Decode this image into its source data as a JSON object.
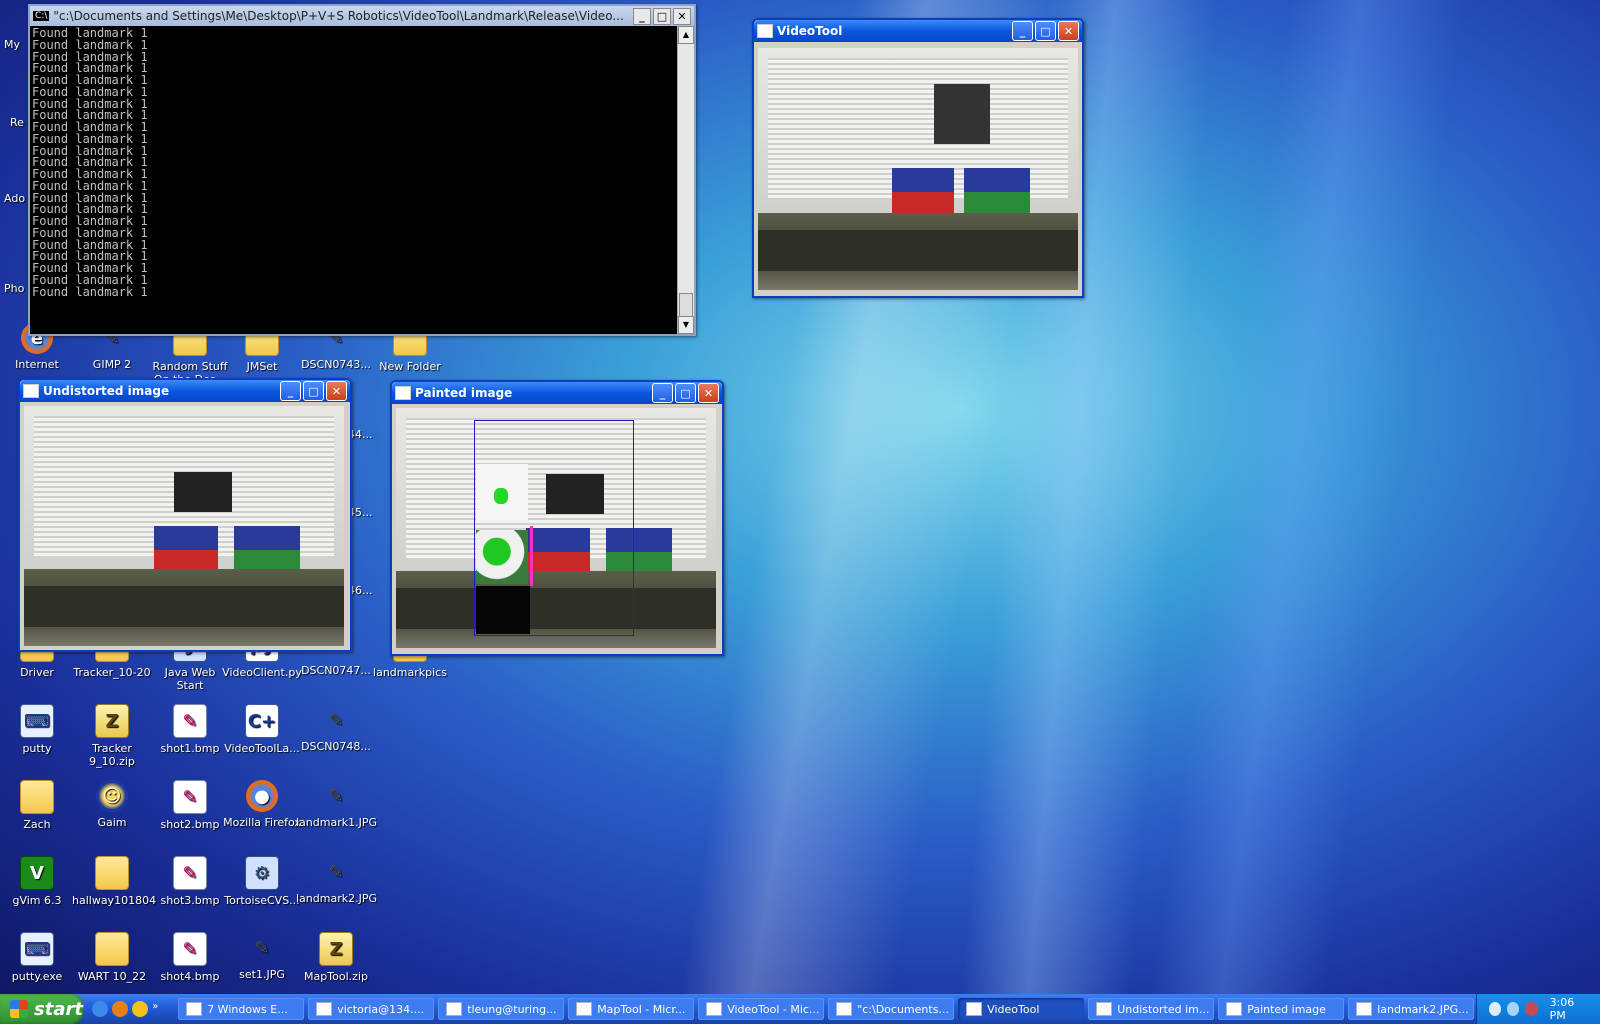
{
  "console": {
    "title": "\"c:\\Documents and Settings\\Me\\Desktop\\P+V+S Robotics\\VideoTool\\Landmark\\Release\\Video...",
    "lines": [
      "Found landmark 1",
      "Found landmark 1",
      "Found landmark 1",
      "Found landmark 1",
      "Found landmark 1",
      "Found landmark 1",
      "Found landmark 1",
      "Found landmark 1",
      "Found landmark 1",
      "Found landmark 1",
      "Found landmark 1",
      "Found landmark 1",
      "Found landmark 1",
      "Found landmark 1",
      "Found landmark 1",
      "Found landmark 1",
      "Found landmark 1",
      "Found landmark 1",
      "Found landmark 1",
      "Found landmark 1",
      "Found landmark 1",
      "Found landmark 1",
      "Found landmark 1"
    ]
  },
  "windows": {
    "videotool": {
      "title": "VideoTool"
    },
    "undistorted": {
      "title": "Undistorted image"
    },
    "painted": {
      "title": "Painted image"
    }
  },
  "desktop_icons": [
    {
      "label": "Internet",
      "kind": "firefox",
      "glyph": "e"
    },
    {
      "label": "GIMP 2",
      "kind": "gimp",
      "glyph": "✎"
    },
    {
      "label": "Random Stuff On the Des...",
      "kind": "folder",
      "glyph": ""
    },
    {
      "label": "JMSet",
      "kind": "folder",
      "glyph": ""
    },
    {
      "label": "DSCN0743...",
      "kind": "gimp",
      "glyph": "✎"
    },
    {
      "label": "New Folder",
      "kind": "folder",
      "glyph": ""
    },
    {
      "label": "Driver",
      "kind": "folder",
      "glyph": ""
    },
    {
      "label": "Tracker_10-20",
      "kind": "folder",
      "glyph": ""
    },
    {
      "label": "Java Web Start",
      "kind": "cvs",
      "glyph": "J"
    },
    {
      "label": "VideoClient.py",
      "kind": "cpp",
      "glyph": "py"
    },
    {
      "label": "DSCN0747...",
      "kind": "gimp",
      "glyph": "✎"
    },
    {
      "label": "landmarkpics",
      "kind": "folder",
      "glyph": ""
    },
    {
      "label": "putty",
      "kind": "putty",
      "glyph": "⌨"
    },
    {
      "label": "Tracker 9_10.zip",
      "kind": "zip",
      "glyph": "Z"
    },
    {
      "label": "shot1.bmp",
      "kind": "bmp",
      "glyph": "✎"
    },
    {
      "label": "VideoToolLa...",
      "kind": "cpp",
      "glyph": "C+"
    },
    {
      "label": "DSCN0748...",
      "kind": "gimp",
      "glyph": "✎"
    },
    {
      "label": "Zach",
      "kind": "folder",
      "glyph": ""
    },
    {
      "label": "Gaim",
      "kind": "gaim",
      "glyph": "☺"
    },
    {
      "label": "shot2.bmp",
      "kind": "bmp",
      "glyph": "✎"
    },
    {
      "label": "Mozilla Firefox",
      "kind": "firefox",
      "glyph": "●"
    },
    {
      "label": "landmark1.JPG",
      "kind": "gimp",
      "glyph": "✎"
    },
    {
      "label": "gVim 6.3",
      "kind": "vim",
      "glyph": "V"
    },
    {
      "label": "hallway101804",
      "kind": "folder",
      "glyph": ""
    },
    {
      "label": "shot3.bmp",
      "kind": "bmp",
      "glyph": "✎"
    },
    {
      "label": "TortoiseCVS...",
      "kind": "cvs",
      "glyph": "⚙"
    },
    {
      "label": "landmark2.JPG",
      "kind": "gimp",
      "glyph": "✎"
    },
    {
      "label": "putty.exe",
      "kind": "putty",
      "glyph": "⌨"
    },
    {
      "label": "WART 10_22",
      "kind": "folder",
      "glyph": ""
    },
    {
      "label": "shot4.bmp",
      "kind": "bmp",
      "glyph": "✎"
    },
    {
      "label": "set1.JPG",
      "kind": "gimp",
      "glyph": "✎"
    },
    {
      "label": "MapTool.zip",
      "kind": "zip",
      "glyph": "Z"
    }
  ],
  "partial_labels": [
    "My",
    "Re",
    "Ado",
    "Pho",
    "44...",
    "45...",
    "46..."
  ],
  "taskbar": {
    "start": "start",
    "tasks": [
      {
        "label": "7 Windows E...",
        "active": false
      },
      {
        "label": "victoria@134....",
        "active": false
      },
      {
        "label": "tleung@turing...",
        "active": false
      },
      {
        "label": "MapTool - Micr...",
        "active": false
      },
      {
        "label": "VideoTool - Mic...",
        "active": false
      },
      {
        "label": "\"c:\\Documents...",
        "active": false
      },
      {
        "label": "VideoTool",
        "active": true
      },
      {
        "label": "Undistorted im...",
        "active": false
      },
      {
        "label": "Painted image",
        "active": false
      },
      {
        "label": "landmark2.JPG...",
        "active": false
      }
    ],
    "clock": "3:06 PM"
  }
}
